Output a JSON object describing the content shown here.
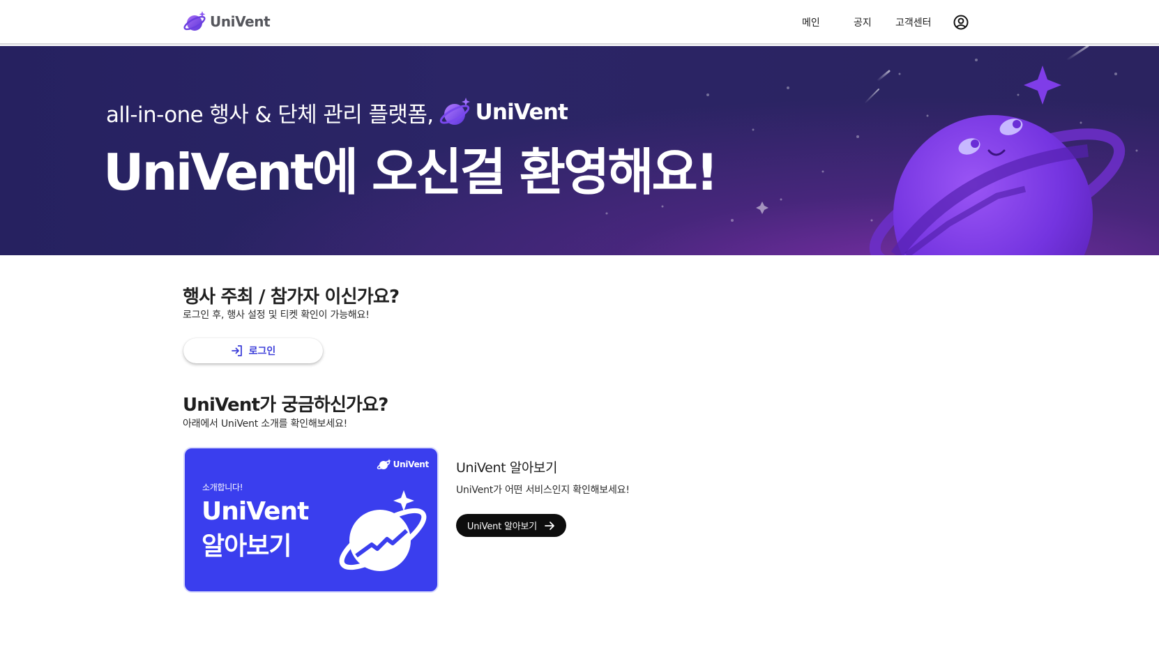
{
  "header": {
    "brand": "UniVent",
    "nav": [
      {
        "label": "메인"
      },
      {
        "label": "공지"
      },
      {
        "label": "고객센터"
      }
    ],
    "user_icon": "user-circle-icon"
  },
  "hero": {
    "subtitle": "all-in-one 행사 & 단체 관리 플랫폼,",
    "subtitle_brand": "UniVent",
    "title": "UniVent에 오신걸 환영해요!",
    "colors": {
      "background": "#2b2566",
      "planet": "#7b3ff0",
      "glow": "#7a2ea6"
    }
  },
  "organizer_section": {
    "title": "행사 주최 / 참가자 이신가요?",
    "description": "로그인 후, 행사 설정 및 티켓 확인이 가능해요!",
    "login_button": "로그인",
    "login_icon": "login-arrow-icon"
  },
  "about_section": {
    "title": "UniVent가 궁금하신가요?",
    "description": "아래에서 UniVent 소개를 확인해보세요!",
    "card": {
      "brand": "UniVent",
      "small_text": "소개합니다!",
      "big_line1": "UniVent",
      "big_line2": "알아보기",
      "color": "#3a3eee"
    },
    "explore_title": "UniVent 알아보기",
    "explore_desc": "UniVent가 어떤 서비스인지 확인해보세요!",
    "explore_button": "UniVent 알아보기",
    "explore_icon": "arrow-right-icon"
  }
}
